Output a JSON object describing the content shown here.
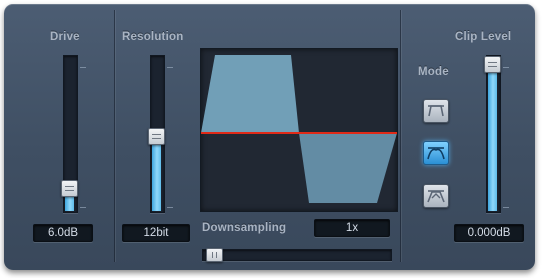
{
  "drive": {
    "label": "Drive",
    "value": "6.0dB",
    "level": 0.16
  },
  "resolution": {
    "label": "Resolution",
    "value": "12bit",
    "level": 0.57
  },
  "downsampling": {
    "label": "Downsampling",
    "value": "1x",
    "level": 0.0
  },
  "clip_level": {
    "label": "Clip Level",
    "value": "0.000dB",
    "level": 1.0
  },
  "mode": {
    "label": "Mode",
    "selected": 1,
    "buttons": [
      {
        "icon": "mode-clip-flat-icon"
      },
      {
        "icon": "mode-clip-fold-icon"
      },
      {
        "icon": "mode-clip-wrap-icon"
      }
    ]
  },
  "colors": {
    "accent": "#59bff2",
    "clip_line": "#e02a18",
    "waveform": "#7fb4cf",
    "panel": "#45566b"
  }
}
